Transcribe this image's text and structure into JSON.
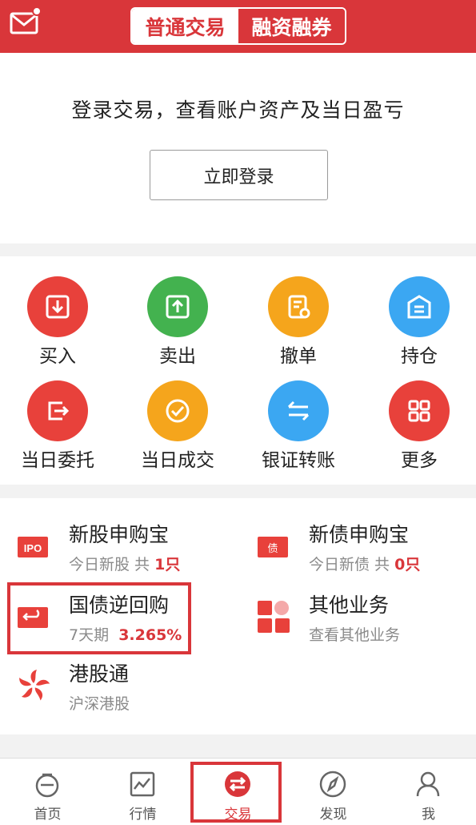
{
  "header": {
    "tabs": [
      {
        "label": "普通交易",
        "active": true
      },
      {
        "label": "融资融券",
        "active": false
      }
    ],
    "mail_icon": "mail-icon",
    "accent_color": "#d9363a"
  },
  "login": {
    "title": "登录交易，查看账户资产及当日盈亏",
    "button": "立即登录"
  },
  "actions": [
    {
      "label": "买入",
      "icon": "buy-icon",
      "color": "#e8413b"
    },
    {
      "label": "卖出",
      "icon": "sell-icon",
      "color": "#43b24f"
    },
    {
      "label": "撤单",
      "icon": "cancel-order-icon",
      "color": "#f5a51c"
    },
    {
      "label": "持仓",
      "icon": "position-icon",
      "color": "#3ba7f2"
    },
    {
      "label": "当日委托",
      "icon": "today-order-icon",
      "color": "#e8413b"
    },
    {
      "label": "当日成交",
      "icon": "today-deal-icon",
      "color": "#f5a51c"
    },
    {
      "label": "银证转账",
      "icon": "transfer-icon",
      "color": "#3ba7f2"
    },
    {
      "label": "更多",
      "icon": "more-icon",
      "color": "#e8413b"
    }
  ],
  "services": {
    "ipo": {
      "title": "新股申购宝",
      "prefix": "今日新股 共 ",
      "count": "1",
      "suffix": "只"
    },
    "bond": {
      "title": "新债申购宝",
      "prefix": "今日新债 共 ",
      "count": "0",
      "suffix": "只"
    },
    "repo": {
      "title": "国债逆回购",
      "period": "7天期",
      "rate": "3.265%"
    },
    "other": {
      "title": "其他业务",
      "sub": "查看其他业务"
    },
    "hk": {
      "title": "港股通",
      "sub": "沪深港股"
    }
  },
  "tabbar": [
    {
      "label": "首页",
      "icon": "home-icon",
      "active": false
    },
    {
      "label": "行情",
      "icon": "market-icon",
      "active": false
    },
    {
      "label": "交易",
      "icon": "trade-icon",
      "active": true
    },
    {
      "label": "发现",
      "icon": "discover-icon",
      "active": false
    },
    {
      "label": "我",
      "icon": "profile-icon",
      "active": false
    }
  ]
}
